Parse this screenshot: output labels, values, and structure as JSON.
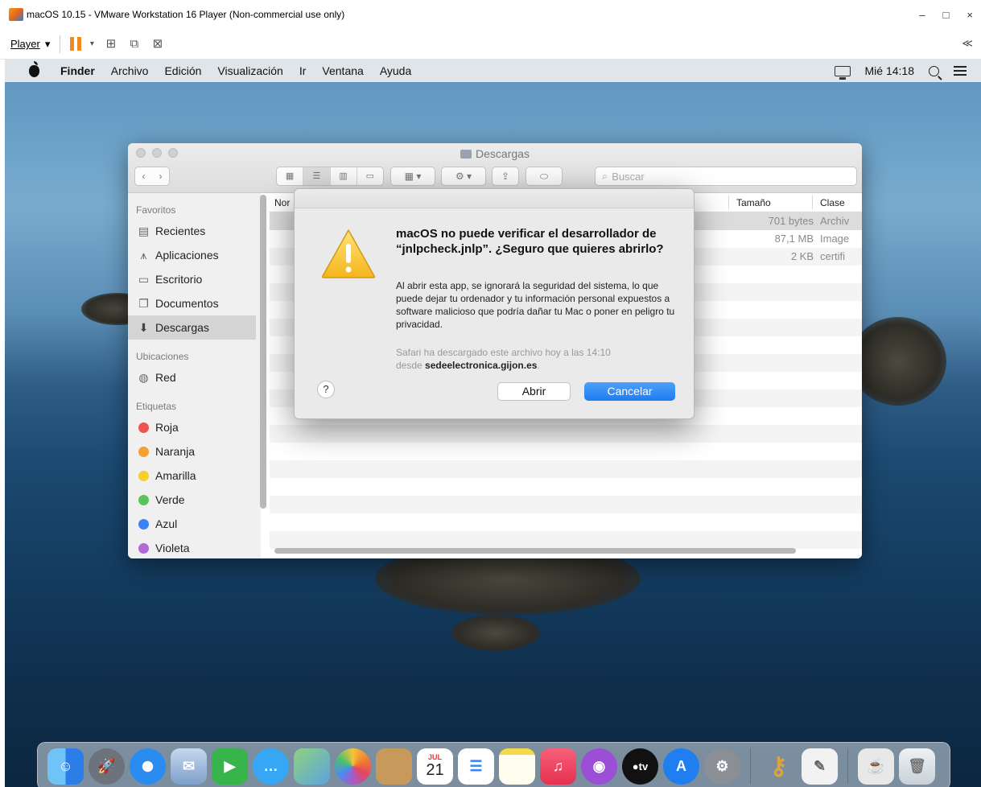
{
  "vm": {
    "title": "macOS 10.15 - VMware Workstation 16 Player (Non-commercial use only)",
    "player_label": "Player",
    "controls": {
      "minimize": "–",
      "maximize": "□",
      "close": "×"
    },
    "collapse": "≪"
  },
  "menubar": {
    "app": "Finder",
    "items": [
      "Archivo",
      "Edición",
      "Visualización",
      "Ir",
      "Ventana",
      "Ayuda"
    ],
    "clock": "Mié 14:18"
  },
  "finder": {
    "title": "Descargas",
    "search_placeholder": "Buscar",
    "sidebar": {
      "favorites_header": "Favoritos",
      "favorites": [
        "Recientes",
        "Aplicaciones",
        "Escritorio",
        "Documentos",
        "Descargas"
      ],
      "locations_header": "Ubicaciones",
      "locations": [
        "Red"
      ],
      "tags_header": "Etiquetas",
      "tags": [
        {
          "label": "Roja",
          "color": "#f0524f"
        },
        {
          "label": "Naranja",
          "color": "#f5a033"
        },
        {
          "label": "Amarilla",
          "color": "#f5cf30"
        },
        {
          "label": "Verde",
          "color": "#5ac35a"
        },
        {
          "label": "Azul",
          "color": "#3b82f6"
        },
        {
          "label": "Violeta",
          "color": "#b06ad6"
        }
      ]
    },
    "columns": {
      "name": "Nor",
      "size": "Tamaño",
      "kind": "Clase"
    },
    "rows": [
      {
        "size": "701 bytes",
        "kind": "Archiv"
      },
      {
        "size": "87,1 MB",
        "kind": "Image"
      },
      {
        "size": "2 KB",
        "kind": "certifi"
      }
    ]
  },
  "alert": {
    "title": "macOS no puede verificar el desarrollador de “jnlpcheck.jnlp”. ¿Seguro que quieres abrirlo?",
    "body": "Al abrir esta app, se ignorará la seguridad del sistema, lo que puede dejar tu ordenador y tu información personal expuestos a software malicioso que podría dañar tu Mac o poner en peligro tu privacidad.",
    "source_line1": "Safari ha descargado este archivo hoy a las 14:10",
    "source_prefix": "desde ",
    "source_domain": "sedeelectronica.gijon.es",
    "source_suffix": ".",
    "help": "?",
    "open_button": "Abrir",
    "cancel_button": "Cancelar"
  },
  "dock": {
    "calendar_month": "JUL",
    "calendar_day": "21",
    "tv_label": "tv",
    "apps": [
      {
        "icon": "finder-icon",
        "color": "#3a8ff0"
      },
      {
        "icon": "launchpad-icon",
        "color": "#7a7f88"
      },
      {
        "icon": "safari-icon",
        "color": "#2b8cf0"
      },
      {
        "icon": "mail-icon",
        "color": "#8fb0d8"
      },
      {
        "icon": "facetime-icon",
        "color": "#37b44a"
      },
      {
        "icon": "messages-icon",
        "color": "#35a7f5"
      },
      {
        "icon": "maps-icon",
        "color": "#6cc46a"
      },
      {
        "icon": "photos-icon",
        "color": "#f0c040"
      },
      {
        "icon": "contacts-icon",
        "color": "#c79a5b"
      },
      {
        "icon": "calendar-icon",
        "color": "#ffffff"
      },
      {
        "icon": "reminders-icon",
        "color": "#ffffff"
      },
      {
        "icon": "notes-icon",
        "color": "#f6e27a"
      },
      {
        "icon": "music-icon",
        "color": "#f0435b"
      },
      {
        "icon": "podcasts-icon",
        "color": "#9b4fd6"
      },
      {
        "icon": "tv-icon",
        "color": "#111111"
      },
      {
        "icon": "app-store-icon",
        "color": "#1f7ef0"
      },
      {
        "icon": "system-preferences-icon",
        "color": "#8a8f96"
      },
      {
        "icon": "keychain-access-icon",
        "color": "#d9a441"
      },
      {
        "icon": "textedit-icon",
        "color": "#f2f2f2"
      },
      {
        "icon": "jnlp-file-icon",
        "color": "#e8e8e8"
      },
      {
        "icon": "trash-icon",
        "color": "#dfe6ec"
      }
    ]
  }
}
